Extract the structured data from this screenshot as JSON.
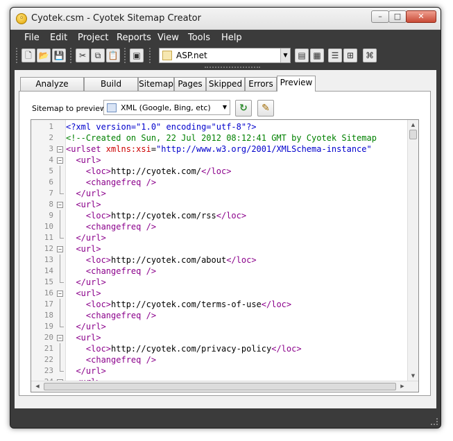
{
  "window": {
    "title": "Cyotek.csm - Cyotek Sitemap Creator",
    "controls": {
      "minimize": "–",
      "maximize": "□",
      "close": "✕"
    }
  },
  "menu": [
    "File",
    "Edit",
    "Project",
    "Reports",
    "View",
    "Tools",
    "Help"
  ],
  "toolbar": {
    "buttons": [
      "new-document-icon",
      "open-folder-icon",
      "save-icon",
      "cut-icon",
      "copy-icon",
      "paste-icon",
      "crawl-icon",
      "report-icon-1",
      "report-icon-2",
      "list-icon",
      "tree-icon",
      "network-icon"
    ],
    "project_type": "ASP.net"
  },
  "tabs": [
    "Analyze Results",
    "Build Results",
    "Sitemap",
    "Pages",
    "Skipped",
    "Errors",
    "Preview"
  ],
  "active_tab": "Preview",
  "preview": {
    "label": "Sitemap to preview:",
    "format": "XML (Google, Bing, etc)"
  },
  "editor": {
    "lines": [
      {
        "n": "1",
        "fold": "",
        "parts": [
          {
            "t": "<?xml version=\"1.0\" encoding=\"utf-8\"?>",
            "c": "c-blue"
          }
        ]
      },
      {
        "n": "2",
        "fold": "",
        "parts": [
          {
            "t": "<!--Created on Sun, 22 Jul 2012 08:12:41 GMT by Cyotek Sitemap",
            "c": "c-green"
          }
        ]
      },
      {
        "n": "3",
        "fold": "open",
        "parts": [
          {
            "t": "<urlset ",
            "c": "c-purple"
          },
          {
            "t": "xmlns:xsi",
            "c": "c-red"
          },
          {
            "t": "=",
            "c": "c-black"
          },
          {
            "t": "\"http://www.w3.org/2001/XMLSchema-instance\"",
            "c": "c-blue"
          }
        ]
      },
      {
        "n": "4",
        "fold": "open",
        "parts": [
          {
            "t": "  <url>",
            "c": "c-purple"
          }
        ]
      },
      {
        "n": "5",
        "fold": "line",
        "parts": [
          {
            "t": "    <loc>",
            "c": "c-purple"
          },
          {
            "t": "http://cyotek.com/",
            "c": "c-black"
          },
          {
            "t": "</loc>",
            "c": "c-purple"
          }
        ]
      },
      {
        "n": "6",
        "fold": "line",
        "parts": [
          {
            "t": "    <changefreq />",
            "c": "c-purple"
          }
        ]
      },
      {
        "n": "7",
        "fold": "end",
        "parts": [
          {
            "t": "  </url>",
            "c": "c-purple"
          }
        ]
      },
      {
        "n": "8",
        "fold": "open",
        "parts": [
          {
            "t": "  <url>",
            "c": "c-purple"
          }
        ]
      },
      {
        "n": "9",
        "fold": "line",
        "parts": [
          {
            "t": "    <loc>",
            "c": "c-purple"
          },
          {
            "t": "http://cyotek.com/rss",
            "c": "c-black"
          },
          {
            "t": "</loc>",
            "c": "c-purple"
          }
        ]
      },
      {
        "n": "10",
        "fold": "line",
        "parts": [
          {
            "t": "    <changefreq />",
            "c": "c-purple"
          }
        ]
      },
      {
        "n": "11",
        "fold": "end",
        "parts": [
          {
            "t": "  </url>",
            "c": "c-purple"
          }
        ]
      },
      {
        "n": "12",
        "fold": "open",
        "parts": [
          {
            "t": "  <url>",
            "c": "c-purple"
          }
        ]
      },
      {
        "n": "13",
        "fold": "line",
        "parts": [
          {
            "t": "    <loc>",
            "c": "c-purple"
          },
          {
            "t": "http://cyotek.com/about",
            "c": "c-black"
          },
          {
            "t": "</loc>",
            "c": "c-purple"
          }
        ]
      },
      {
        "n": "14",
        "fold": "line",
        "parts": [
          {
            "t": "    <changefreq />",
            "c": "c-purple"
          }
        ]
      },
      {
        "n": "15",
        "fold": "end",
        "parts": [
          {
            "t": "  </url>",
            "c": "c-purple"
          }
        ]
      },
      {
        "n": "16",
        "fold": "open",
        "parts": [
          {
            "t": "  <url>",
            "c": "c-purple"
          }
        ]
      },
      {
        "n": "17",
        "fold": "line",
        "parts": [
          {
            "t": "    <loc>",
            "c": "c-purple"
          },
          {
            "t": "http://cyotek.com/terms-of-use",
            "c": "c-black"
          },
          {
            "t": "</loc>",
            "c": "c-purple"
          }
        ]
      },
      {
        "n": "18",
        "fold": "line",
        "parts": [
          {
            "t": "    <changefreq />",
            "c": "c-purple"
          }
        ]
      },
      {
        "n": "19",
        "fold": "end",
        "parts": [
          {
            "t": "  </url>",
            "c": "c-purple"
          }
        ]
      },
      {
        "n": "20",
        "fold": "open",
        "parts": [
          {
            "t": "  <url>",
            "c": "c-purple"
          }
        ]
      },
      {
        "n": "21",
        "fold": "line",
        "parts": [
          {
            "t": "    <loc>",
            "c": "c-purple"
          },
          {
            "t": "http://cyotek.com/privacy-policy",
            "c": "c-black"
          },
          {
            "t": "</loc>",
            "c": "c-purple"
          }
        ]
      },
      {
        "n": "22",
        "fold": "line",
        "parts": [
          {
            "t": "    <changefreq />",
            "c": "c-purple"
          }
        ]
      },
      {
        "n": "23",
        "fold": "end",
        "parts": [
          {
            "t": "  </url>",
            "c": "c-purple"
          }
        ]
      },
      {
        "n": "24",
        "fold": "open",
        "parts": [
          {
            "t": "  <url>",
            "c": "c-purple"
          }
        ]
      }
    ]
  }
}
